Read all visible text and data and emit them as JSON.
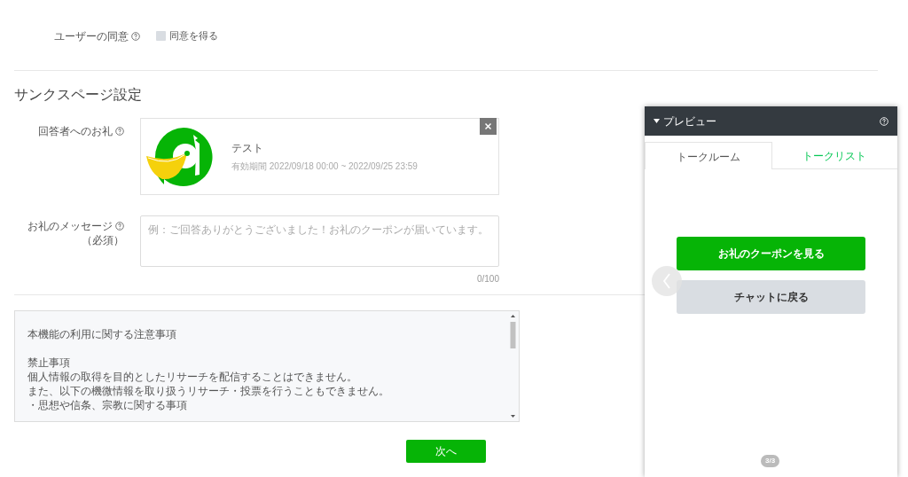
{
  "consent": {
    "label": "ユーザーの同意",
    "checkbox_label": "同意を得る",
    "checked": false
  },
  "section_title": "サンクスページ設定",
  "reward": {
    "label": "回答者へのお礼",
    "coupon": {
      "name": "テスト",
      "validity": "有効期間 2022/09/18 00:00 ~ 2022/09/25 23:59"
    }
  },
  "message": {
    "label": "お礼のメッセージ",
    "required": "（必須）",
    "placeholder": "例：ご回答ありがとうございました！お礼のクーポンが届いています。",
    "counter": "0/100"
  },
  "notes": {
    "paragraphs": [
      [
        "本機能の利用に関する注意事項"
      ],
      [
        "禁止事項",
        "個人情報の取得を目的としたリサーチを配信することはできません。",
        "また、以下の機微情報を取り扱うリサーチ・投票を行うこともできません。",
        "・思想や信条、宗教に関する事項"
      ]
    ]
  },
  "next_button": "次へ",
  "preview": {
    "title": "プレビュー",
    "tabs": [
      {
        "label": "トークルーム",
        "selected": true
      },
      {
        "label": "トークリスト",
        "selected": false
      }
    ],
    "buttons": [
      {
        "label": "お礼のクーポンを見る",
        "kind": "primary"
      },
      {
        "label": "チャットに戻る",
        "kind": "secondary"
      }
    ],
    "page_indicator": "3/3"
  }
}
